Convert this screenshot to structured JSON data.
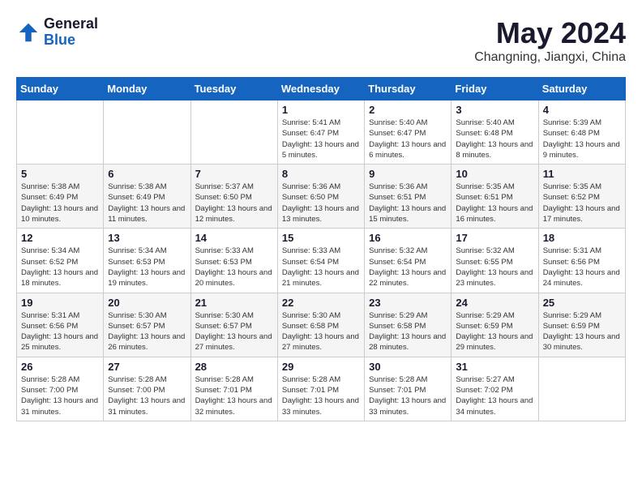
{
  "header": {
    "logo_line1": "General",
    "logo_line2": "Blue",
    "month_year": "May 2024",
    "location": "Changning, Jiangxi, China"
  },
  "days_of_week": [
    "Sunday",
    "Monday",
    "Tuesday",
    "Wednesday",
    "Thursday",
    "Friday",
    "Saturday"
  ],
  "weeks": [
    [
      {
        "day": "",
        "info": ""
      },
      {
        "day": "",
        "info": ""
      },
      {
        "day": "",
        "info": ""
      },
      {
        "day": "1",
        "info": "Sunrise: 5:41 AM\nSunset: 6:47 PM\nDaylight: 13 hours and 5 minutes."
      },
      {
        "day": "2",
        "info": "Sunrise: 5:40 AM\nSunset: 6:47 PM\nDaylight: 13 hours and 6 minutes."
      },
      {
        "day": "3",
        "info": "Sunrise: 5:40 AM\nSunset: 6:48 PM\nDaylight: 13 hours and 8 minutes."
      },
      {
        "day": "4",
        "info": "Sunrise: 5:39 AM\nSunset: 6:48 PM\nDaylight: 13 hours and 9 minutes."
      }
    ],
    [
      {
        "day": "5",
        "info": "Sunrise: 5:38 AM\nSunset: 6:49 PM\nDaylight: 13 hours and 10 minutes."
      },
      {
        "day": "6",
        "info": "Sunrise: 5:38 AM\nSunset: 6:49 PM\nDaylight: 13 hours and 11 minutes."
      },
      {
        "day": "7",
        "info": "Sunrise: 5:37 AM\nSunset: 6:50 PM\nDaylight: 13 hours and 12 minutes."
      },
      {
        "day": "8",
        "info": "Sunrise: 5:36 AM\nSunset: 6:50 PM\nDaylight: 13 hours and 13 minutes."
      },
      {
        "day": "9",
        "info": "Sunrise: 5:36 AM\nSunset: 6:51 PM\nDaylight: 13 hours and 15 minutes."
      },
      {
        "day": "10",
        "info": "Sunrise: 5:35 AM\nSunset: 6:51 PM\nDaylight: 13 hours and 16 minutes."
      },
      {
        "day": "11",
        "info": "Sunrise: 5:35 AM\nSunset: 6:52 PM\nDaylight: 13 hours and 17 minutes."
      }
    ],
    [
      {
        "day": "12",
        "info": "Sunrise: 5:34 AM\nSunset: 6:52 PM\nDaylight: 13 hours and 18 minutes."
      },
      {
        "day": "13",
        "info": "Sunrise: 5:34 AM\nSunset: 6:53 PM\nDaylight: 13 hours and 19 minutes."
      },
      {
        "day": "14",
        "info": "Sunrise: 5:33 AM\nSunset: 6:53 PM\nDaylight: 13 hours and 20 minutes."
      },
      {
        "day": "15",
        "info": "Sunrise: 5:33 AM\nSunset: 6:54 PM\nDaylight: 13 hours and 21 minutes."
      },
      {
        "day": "16",
        "info": "Sunrise: 5:32 AM\nSunset: 6:54 PM\nDaylight: 13 hours and 22 minutes."
      },
      {
        "day": "17",
        "info": "Sunrise: 5:32 AM\nSunset: 6:55 PM\nDaylight: 13 hours and 23 minutes."
      },
      {
        "day": "18",
        "info": "Sunrise: 5:31 AM\nSunset: 6:56 PM\nDaylight: 13 hours and 24 minutes."
      }
    ],
    [
      {
        "day": "19",
        "info": "Sunrise: 5:31 AM\nSunset: 6:56 PM\nDaylight: 13 hours and 25 minutes."
      },
      {
        "day": "20",
        "info": "Sunrise: 5:30 AM\nSunset: 6:57 PM\nDaylight: 13 hours and 26 minutes."
      },
      {
        "day": "21",
        "info": "Sunrise: 5:30 AM\nSunset: 6:57 PM\nDaylight: 13 hours and 27 minutes."
      },
      {
        "day": "22",
        "info": "Sunrise: 5:30 AM\nSunset: 6:58 PM\nDaylight: 13 hours and 27 minutes."
      },
      {
        "day": "23",
        "info": "Sunrise: 5:29 AM\nSunset: 6:58 PM\nDaylight: 13 hours and 28 minutes."
      },
      {
        "day": "24",
        "info": "Sunrise: 5:29 AM\nSunset: 6:59 PM\nDaylight: 13 hours and 29 minutes."
      },
      {
        "day": "25",
        "info": "Sunrise: 5:29 AM\nSunset: 6:59 PM\nDaylight: 13 hours and 30 minutes."
      }
    ],
    [
      {
        "day": "26",
        "info": "Sunrise: 5:28 AM\nSunset: 7:00 PM\nDaylight: 13 hours and 31 minutes."
      },
      {
        "day": "27",
        "info": "Sunrise: 5:28 AM\nSunset: 7:00 PM\nDaylight: 13 hours and 31 minutes."
      },
      {
        "day": "28",
        "info": "Sunrise: 5:28 AM\nSunset: 7:01 PM\nDaylight: 13 hours and 32 minutes."
      },
      {
        "day": "29",
        "info": "Sunrise: 5:28 AM\nSunset: 7:01 PM\nDaylight: 13 hours and 33 minutes."
      },
      {
        "day": "30",
        "info": "Sunrise: 5:28 AM\nSunset: 7:01 PM\nDaylight: 13 hours and 33 minutes."
      },
      {
        "day": "31",
        "info": "Sunrise: 5:27 AM\nSunset: 7:02 PM\nDaylight: 13 hours and 34 minutes."
      },
      {
        "day": "",
        "info": ""
      }
    ]
  ]
}
